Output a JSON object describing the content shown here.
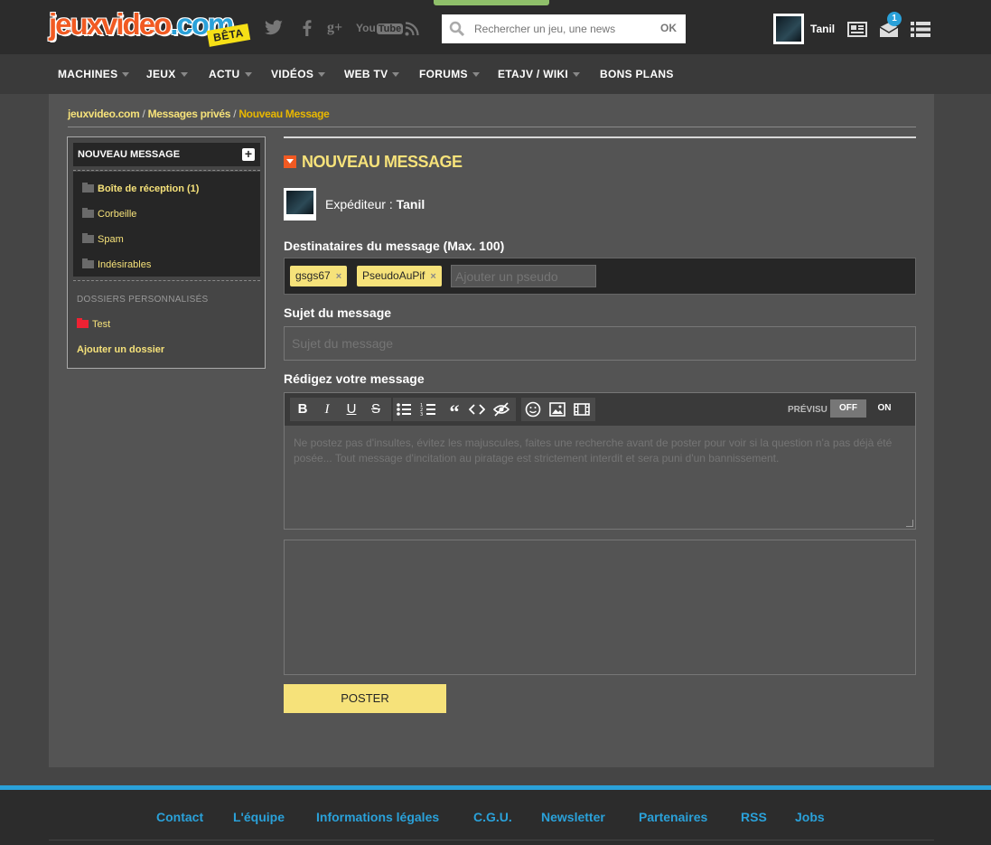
{
  "header": {
    "logo": {
      "main": "jeuxvideo",
      "suffix": ".com",
      "tag": "BÊTA"
    },
    "social": [
      "twitter-icon",
      "facebook-icon",
      "googleplus-icon",
      "youtube-icon",
      "rss-icon"
    ],
    "youtube_label": "You",
    "search": {
      "placeholder": "Rechercher un jeu, une news",
      "button": "OK"
    },
    "user": {
      "name": "Tanil"
    },
    "notifications": {
      "messages_count": "1"
    }
  },
  "nav": {
    "items": [
      {
        "label": "MACHINES"
      },
      {
        "label": "JEUX"
      },
      {
        "label": "ACTU"
      },
      {
        "label": "VIDÉOS"
      },
      {
        "label": "WEB TV"
      },
      {
        "label": "FORUMS"
      },
      {
        "label": "ETAJV / WIKI"
      },
      {
        "label": "BONS PLANS"
      }
    ]
  },
  "breadcrumb": {
    "items": [
      "jeuxvideo.com",
      "Messages privés"
    ],
    "separator": "/",
    "current": "Nouveau Message"
  },
  "sidebar": {
    "title": "NOUVEAU MESSAGE",
    "plus": "+",
    "folders": [
      {
        "label": "Boîte de réception (1)"
      },
      {
        "label": "Corbeille"
      },
      {
        "label": "Spam"
      },
      {
        "label": "Indésirables"
      }
    ],
    "custom_title": "DOSSIERS PERSONNALISÉS",
    "custom_folders": [
      {
        "label": "Test"
      }
    ],
    "add_folder": "Ajouter un dossier"
  },
  "main": {
    "title": "NOUVEAU MESSAGE",
    "sender_label": "Expéditeur :",
    "sender_name": "Tanil",
    "recipients_label": "Destinataires du message (Max. 100)",
    "recipients": [
      {
        "name": "gsgs67"
      },
      {
        "name": "PseudoAuPif"
      }
    ],
    "tag_remove": "×",
    "pseudo_placeholder": "Ajouter un pseudo",
    "subject_label": "Sujet du message",
    "subject_placeholder": "Sujet du message",
    "message_label": "Rédigez votre message",
    "message_placeholder": "Ne postez pas d'insultes, évitez les majuscules, faites une recherche avant de poster pour voir si la question n'a pas déjà été posée... Tout message d'incitation au piratage est strictement interdit et sera puni d'un bannissement.",
    "preview_label": "PRÉVISU",
    "toggle_off": "OFF",
    "toggle_on": "ON",
    "submit": "POSTER"
  },
  "footer": {
    "links": [
      {
        "label": "Contact"
      },
      {
        "label": "L'équipe"
      },
      {
        "label": "Informations légales"
      },
      {
        "label": "C.G.U."
      },
      {
        "label": "Newsletter"
      },
      {
        "label": "Partenaires"
      },
      {
        "label": "RSS"
      },
      {
        "label": "Jobs"
      }
    ]
  },
  "colors": {
    "accent_yellow": "#f6e27a",
    "brand_orange": "#f15a22",
    "brand_blue": "#2aa1d9"
  }
}
